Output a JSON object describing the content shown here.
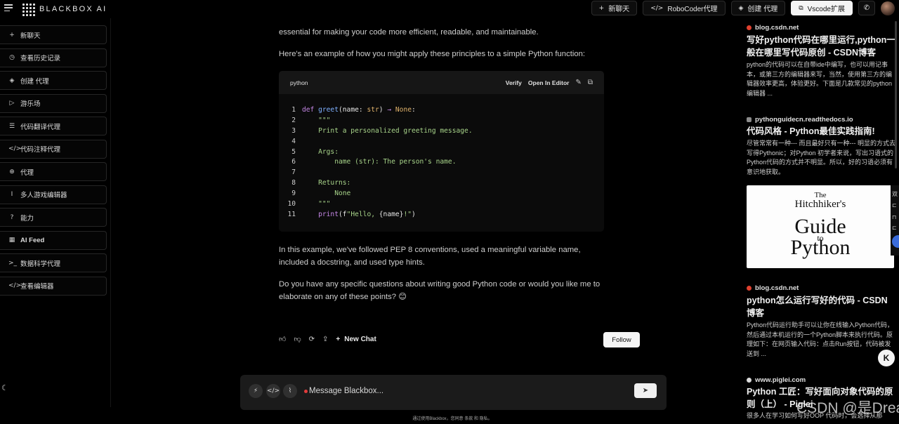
{
  "brand": {
    "name": "BLACKBOX AI"
  },
  "top_actions": [
    {
      "icon": "plus-icon",
      "glyph": "+",
      "label": "新聊天",
      "style": "dark"
    },
    {
      "icon": "code-icon",
      "glyph": "</>",
      "label": "RoboCoder代理",
      "style": "dark"
    },
    {
      "icon": "layers-icon",
      "glyph": "◈",
      "label": "创建 代理",
      "style": "dark"
    },
    {
      "icon": "vscode-icon",
      "glyph": "⧉",
      "label": "Vscode扩展",
      "style": "light"
    }
  ],
  "sidebar": {
    "items": [
      {
        "icon": "plus-icon",
        "glyph": "+",
        "label": "新聊天"
      },
      {
        "icon": "clock-icon",
        "glyph": "◷",
        "label": "查看历史记录"
      },
      {
        "icon": "layers-icon",
        "glyph": "◈",
        "label": "创建 代理"
      },
      {
        "icon": "play-icon",
        "glyph": "▷",
        "label": "游乐场"
      },
      {
        "icon": "list-icon",
        "glyph": "☰",
        "label": "代码翻译代理"
      },
      {
        "icon": "code-icon",
        "glyph": "</>",
        "label": "代码注释代理"
      },
      {
        "icon": "globe-icon",
        "glyph": "⊕",
        "label": "代理"
      },
      {
        "icon": "cursor-icon",
        "glyph": "I",
        "label": "多人游戏编辑器"
      },
      {
        "icon": "question-icon",
        "glyph": "?",
        "label": "能力"
      },
      {
        "icon": "grid-icon",
        "glyph": "▦",
        "label": "AI Feed",
        "bold": true
      },
      {
        "icon": "terminal-icon",
        "glyph": ">_",
        "label": "数据科学代理"
      },
      {
        "icon": "code-icon",
        "glyph": "</>",
        "label": "查看编辑器"
      }
    ]
  },
  "chat": {
    "intro_fragment": "essential for making your code more efficient, readable, and maintainable.",
    "example_intro": "Here's an example of how you might apply these principles to a simple Python function:",
    "code": {
      "language": "python",
      "verify_label": "Verify",
      "open_editor_label": "Open In Editor",
      "lines": [
        "def greet(name: str) -> None:",
        "    \"\"\"",
        "    Print a personalized greeting message.",
        "",
        "    Args:",
        "        name (str): The person's name.",
        "",
        "    Returns:",
        "        None",
        "    \"\"\"",
        "    print(f\"Hello, {name}!\")"
      ]
    },
    "summary": "In this example, we've followed PEP 8 conventions, used a meaningful variable name, included a docstring, and used type hints.",
    "question": "Do you have any specific questions about writing good Python code or would you like me to elaborate on any of these points? 😊",
    "new_chat_label": "New Chat",
    "follow_label": "Follow"
  },
  "composer": {
    "placeholder": "Message Blackbox..."
  },
  "footer": "通过使用Blackbox，您同意 条款 和 隐私。",
  "sources": [
    {
      "domain": "blog.csdn.net",
      "title": "写好python代码在哪里运行,python一般在哪里写代码原创 - CSDN博客",
      "desc": "python的代码可以在自带ide中编写，也可以用记事本，或第三方的编辑器来写，当然，使用第三方的编辑器效率更高，体验更好。下面是几款常见的python编辑器 ..."
    },
    {
      "domain": "pythonguidecn.readthedocs.io",
      "title": "代码风格 - Python最佳实践指南!",
      "desc": "尽管常常有一种--- 而且最好只有一种--- 明显的方式去写得Pythonic；对Python 初学者来说，写出习语式的Python代码的方式并不明显。所以，好的习语必须有意识地获取。"
    },
    {
      "domain": "blog.csdn.net",
      "title": "python怎么运行写好的代码 - CSDN博客",
      "desc": "Python代码运行助手可以让你在线输入Python代码，然后通过本机运行的一个Python脚本来执行代码。原理如下：在网页输入代码：点击Run按钮，代码被发送到 ..."
    },
    {
      "domain": "www.piglei.com",
      "title": "Python 工匠：写好面向对象代码的原则（上） - Piglei",
      "desc": "很多人在学习如何写好OOP 代码时，会选择从那"
    }
  ],
  "book_cover": {
    "line1": "The",
    "line2": "Hitchhiker's",
    "line3": "Guide",
    "line4": "to",
    "line5": "Python"
  },
  "edge_label": "双",
  "watermark": "CSDN @是Dream呀",
  "colors": {
    "background": "#000000",
    "accent_dot": "#e23b3b",
    "keyword": "#c587e6",
    "string": "#a8d48a",
    "function": "#7fb0ff"
  }
}
